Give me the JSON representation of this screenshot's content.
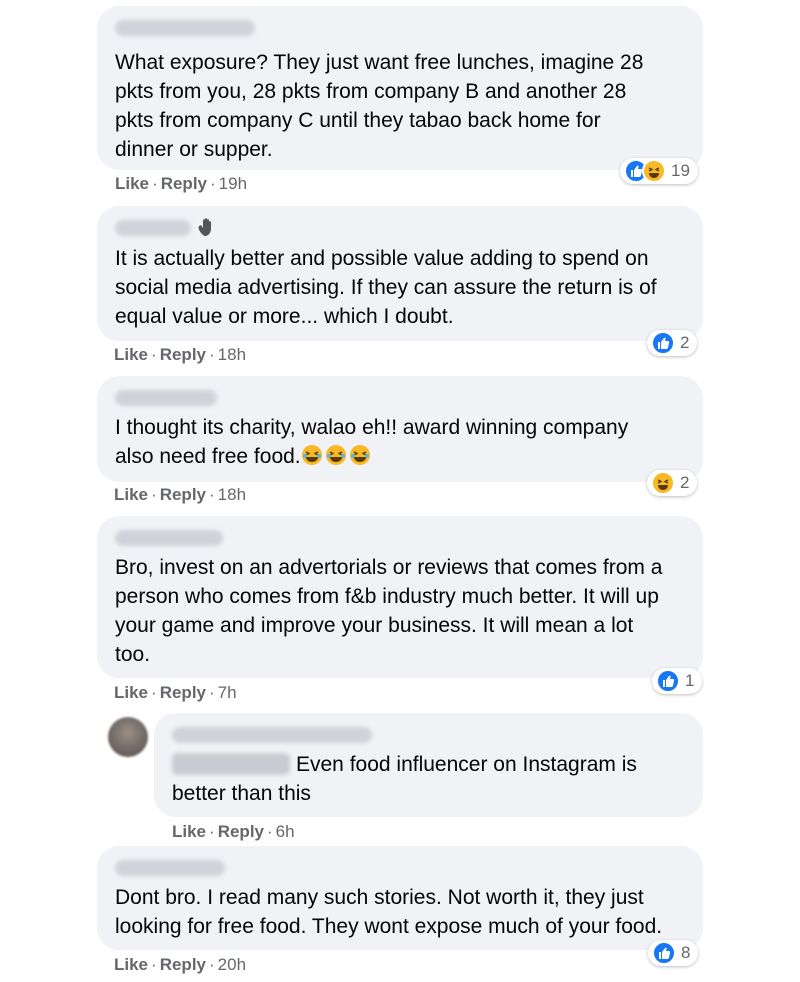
{
  "actions": {
    "like": "Like",
    "reply": "Reply",
    "sep": "·"
  },
  "colors": {
    "like_blue": "#1877f2",
    "haha_yellow": "#f7b928",
    "bubble": "#f0f2f5",
    "meta_gray": "#65676b"
  },
  "comments": [
    {
      "lines": [
        "What exposure? They just want free lunches, imagine 28",
        "pkts from you, 28 pkts from company B and another 28",
        "pkts from company C until they tabao back home for",
        "dinner or supper."
      ],
      "time": "19h",
      "reactions": [
        "like-icon",
        "haha-icon"
      ],
      "reaction_count": "19"
    },
    {
      "lines": [
        "It is actually better and possible value adding to spend on",
        "social media advertising. If they can assure the return is of",
        "equal value or more... which I doubt."
      ],
      "time": "18h",
      "reactions": [
        "like-icon"
      ],
      "reaction_count": "2"
    },
    {
      "lines": [
        "I thought its charity, walao eh!! award winning company",
        "also need free food."
      ],
      "time": "18h",
      "reactions": [
        "haha-icon"
      ],
      "reaction_count": "2"
    },
    {
      "lines": [
        "Bro, invest on an advertorials or reviews that comes from a",
        "person who comes from f&b industry much better. It will up",
        "your game and improve your business. It will mean a lot",
        "too."
      ],
      "time": "7h",
      "reactions": [
        "like-icon"
      ],
      "reaction_count": "1"
    },
    {
      "lines": [
        "Even food influencer on Instagram is",
        "better than this"
      ],
      "time": "6h",
      "reactions": [],
      "reaction_count": ""
    },
    {
      "lines": [
        "Dont bro. I read many such stories. Not worth it, they just",
        "looking for free food. They wont expose much of your food."
      ],
      "time": "20h",
      "reactions": [
        "like-icon"
      ],
      "reaction_count": "8"
    }
  ]
}
